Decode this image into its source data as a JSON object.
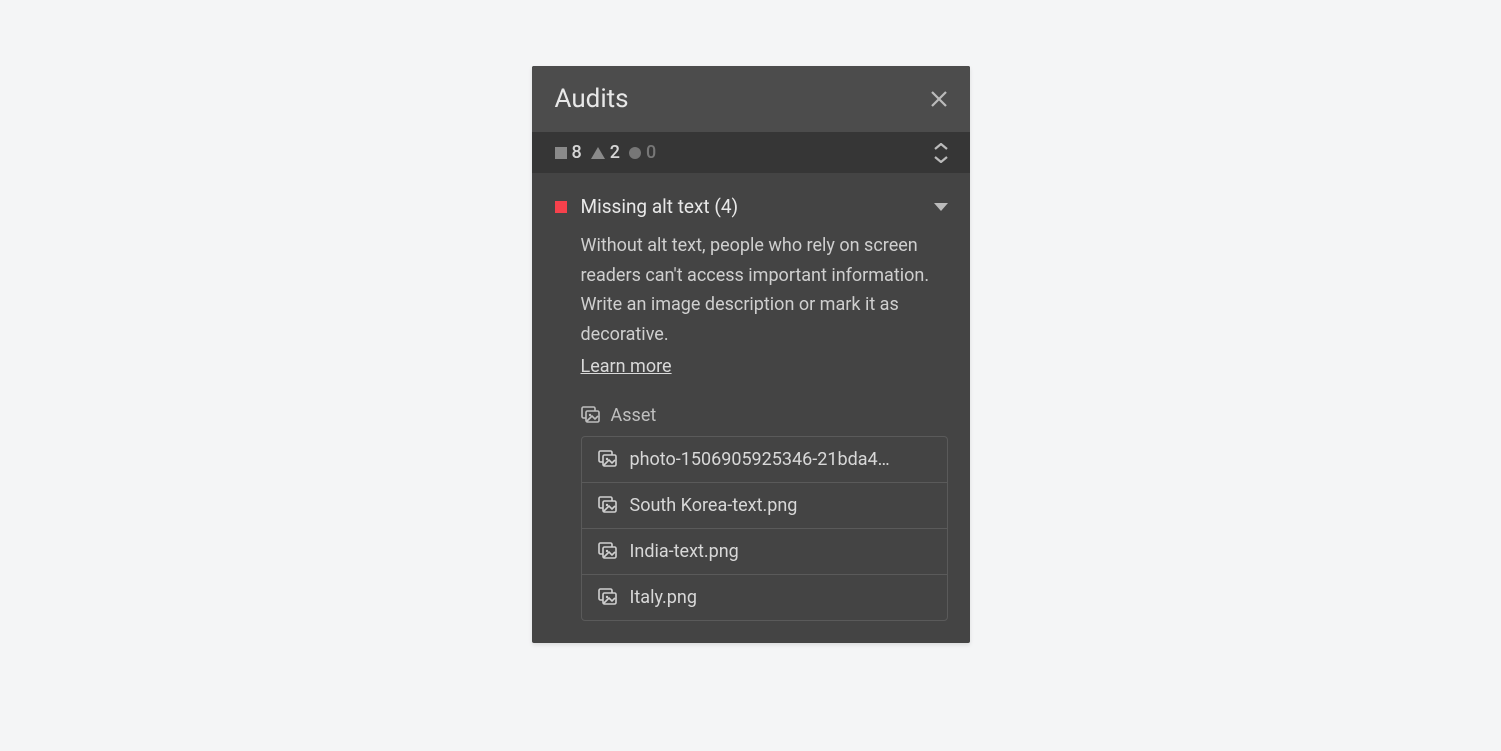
{
  "panel": {
    "title": "Audits"
  },
  "summary": {
    "errors": "8",
    "warnings": "2",
    "others": "0"
  },
  "issue": {
    "title": "Missing alt text",
    "count": "(4)",
    "description": "Without alt text, people who rely on screen readers can't access important information. Write an image description or mark it as decorative.",
    "learn_more": "Learn more",
    "asset_label": "Asset",
    "assets": [
      "photo-1506905925346-21bda4…",
      "South Korea-text.png",
      "India-text.png",
      "Italy.png"
    ]
  }
}
